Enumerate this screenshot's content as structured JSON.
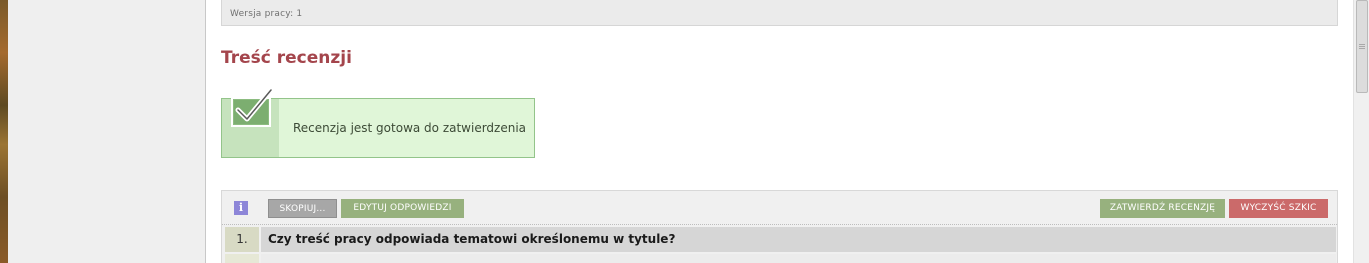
{
  "version": {
    "label": "Wersja pracy: 1"
  },
  "section": {
    "title": "Treść recenzji"
  },
  "status": {
    "message": "Recenzja jest gotowa do zatwierdzenia",
    "icon": "checkmark-icon"
  },
  "toolbar": {
    "info_icon": "info-icon",
    "info_glyph": "i",
    "copy_label": "SKOPIUJ...",
    "edit_label": "EDYTUJ ODPOWIEDZI",
    "approve_label": "ZATWIERDŹ RECENZJĘ",
    "clear_label": "WYCZYŚĆ SZKIC"
  },
  "questions": [
    {
      "number": "1.",
      "text": "Czy treść pracy odpowiada tematowi określonemu w tytule?"
    }
  ],
  "colors": {
    "title": "#a4454c",
    "status_bg": "#e0f6d8",
    "edit_button": "#97b17e",
    "approve_button": "#97b17e",
    "clear_button": "#cb6a6a",
    "copy_button": "#a7a7a7",
    "info_icon": "#8d86d8"
  }
}
